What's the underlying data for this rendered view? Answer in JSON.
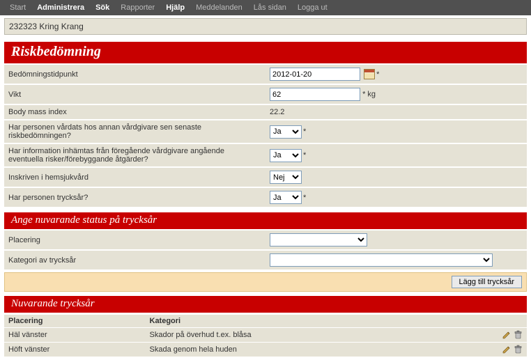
{
  "nav": {
    "items": [
      {
        "label": "Start",
        "active": false
      },
      {
        "label": "Administrera",
        "active": true
      },
      {
        "label": "Sök",
        "active": true
      },
      {
        "label": "Rapporter",
        "active": false
      },
      {
        "label": "Hjälp",
        "active": true
      },
      {
        "label": "Meddelanden",
        "active": false
      },
      {
        "label": "Lås sidan",
        "active": false
      },
      {
        "label": "Logga ut",
        "active": false
      }
    ]
  },
  "patient": "232323 Kring Krang",
  "risk": {
    "title": "Riskbedömning",
    "rows": {
      "bed_tid_label": "Bedömningstidpunkt",
      "bed_tid_value": "2012-01-20",
      "vikt_label": "Vikt",
      "vikt_value": "62",
      "vikt_unit": "* kg",
      "bmi_label": "Body mass index",
      "bmi_value": "22.2",
      "q1_label": "Har personen vårdats hos annan vårdgivare sen senaste riskbedömningen?",
      "q1_value": "Ja",
      "q2_label": "Har information inhämtas från föregående vårdgivare angående eventuella risker/förebyggande åtgärder?",
      "q2_value": "Ja",
      "q3_label": "Inskriven i hemsjukvård",
      "q3_value": "Nej",
      "q4_label": "Har personen trycksår?",
      "q4_value": "Ja"
    }
  },
  "status": {
    "title": "Ange nuvarande status på trycksår",
    "placering_label": "Placering",
    "placering_value": "",
    "kategori_label": "Kategori av trycksår",
    "kategori_value": "",
    "add_btn": "Lägg till trycksår"
  },
  "current": {
    "title": "Nuvarande trycksår",
    "headers": {
      "placering": "Placering",
      "kategori": "Kategori"
    },
    "rows": [
      {
        "placering": "Häl vänster",
        "kategori": "Skador på överhud t.ex. blåsa"
      },
      {
        "placering": "Höft vänster",
        "kategori": "Skada genom hela huden"
      }
    ]
  },
  "req_mark": "*"
}
